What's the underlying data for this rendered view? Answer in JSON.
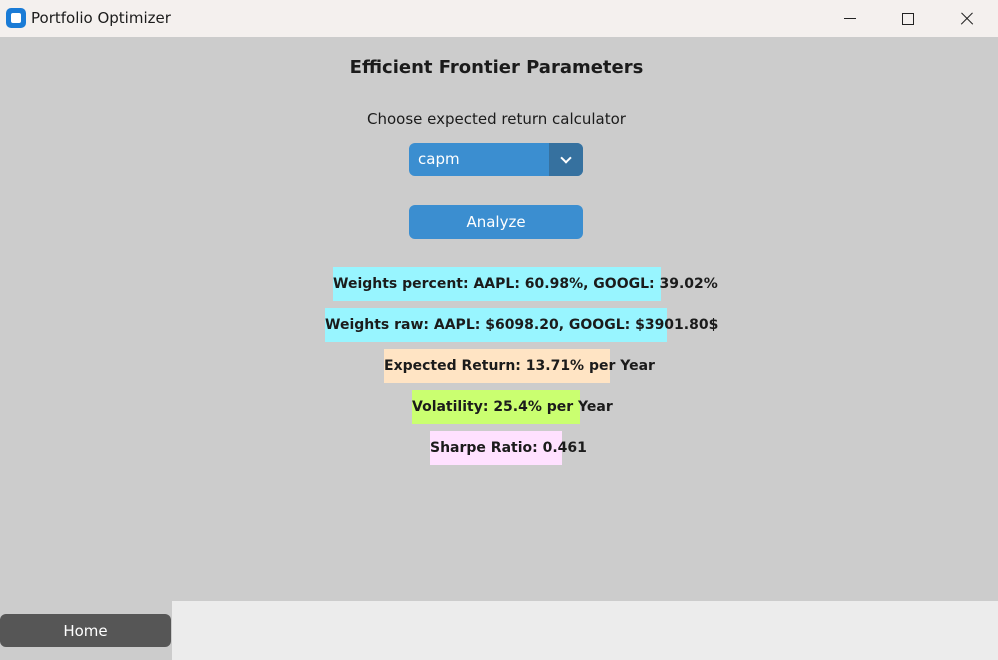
{
  "window": {
    "title": "Portfolio Optimizer",
    "icons": [
      "app-icon",
      "minimize-icon",
      "maximize-icon",
      "close-icon"
    ]
  },
  "main": {
    "heading": "Efficient Frontier Parameters",
    "calculator_label": "Choose expected return calculator",
    "calculator_select": {
      "value": "capm",
      "icon": "chevron-down-icon"
    },
    "analyze_label": "Analyze",
    "results": {
      "weights_percent": "Weights percent: AAPL: 60.98%, GOOGL: 39.02%",
      "weights_raw": "Weights raw: AAPL: $6098.20, GOOGL: $3901.80$",
      "expected_return": "Expected Return: 13.71% per Year",
      "volatility": "Volatility: 25.4% per Year",
      "sharpe_ratio": "Sharpe Ratio: 0.461"
    }
  },
  "nav": {
    "home_label": "Home"
  },
  "colors": {
    "primary_button": "#3b8ed0",
    "dropdown_arrow": "#36719f",
    "weights_bg": "#98f5ff",
    "return_bg": "#ffe4c4",
    "volatility_bg": "#caff70",
    "sharpe_bg": "#ffe1ff",
    "home_button": "#565656"
  }
}
